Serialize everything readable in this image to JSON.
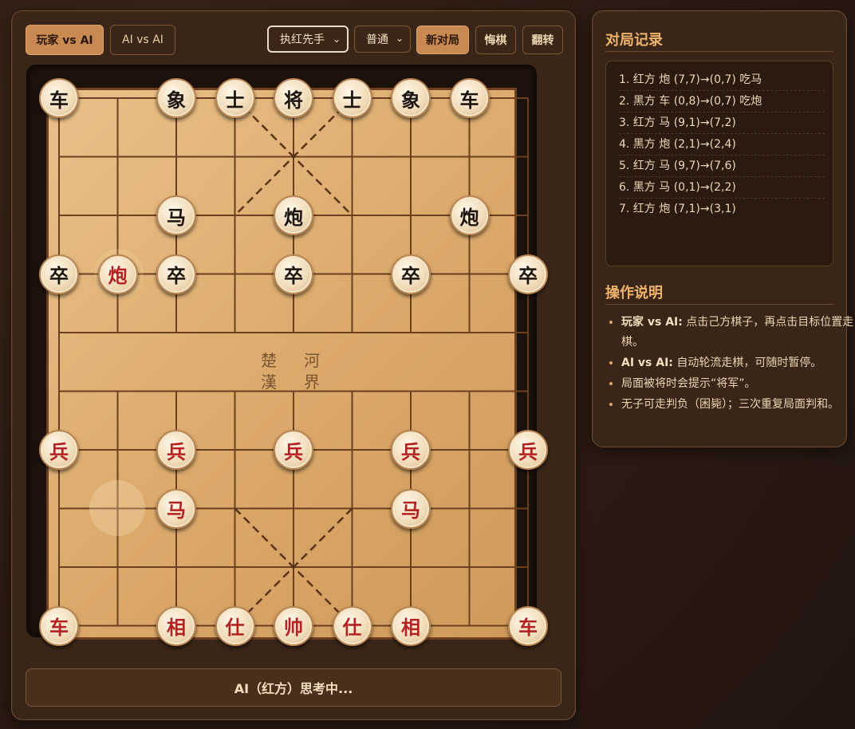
{
  "tabs": [
    {
      "label": "玩家 vs AI",
      "active": true
    },
    {
      "label": "AI vs AI",
      "active": false
    }
  ],
  "controls": {
    "side_select": "执红先手",
    "level_select": "普通",
    "new_game": "新对局",
    "undo": "悔棋",
    "flip": "翻转"
  },
  "board": {
    "river_left": [
      "楚",
      "漢"
    ],
    "river_right": [
      "河",
      "界"
    ],
    "pieces": [
      {
        "col": 0,
        "row": 0,
        "char": "车",
        "side": "black"
      },
      {
        "col": 2,
        "row": 0,
        "char": "象",
        "side": "black"
      },
      {
        "col": 3,
        "row": 0,
        "char": "士",
        "side": "black"
      },
      {
        "col": 4,
        "row": 0,
        "char": "将",
        "side": "black"
      },
      {
        "col": 5,
        "row": 0,
        "char": "士",
        "side": "black"
      },
      {
        "col": 6,
        "row": 0,
        "char": "象",
        "side": "black"
      },
      {
        "col": 7,
        "row": 0,
        "char": "车",
        "side": "black"
      },
      {
        "col": 2,
        "row": 2,
        "char": "马",
        "side": "black"
      },
      {
        "col": 4,
        "row": 2,
        "char": "炮",
        "side": "black"
      },
      {
        "col": 7,
        "row": 2,
        "char": "炮",
        "side": "black"
      },
      {
        "col": 0,
        "row": 3,
        "char": "卒",
        "side": "black"
      },
      {
        "col": 1,
        "row": 3,
        "char": "炮",
        "side": "red"
      },
      {
        "col": 2,
        "row": 3,
        "char": "卒",
        "side": "black"
      },
      {
        "col": 4,
        "row": 3,
        "char": "卒",
        "side": "black"
      },
      {
        "col": 6,
        "row": 3,
        "char": "卒",
        "side": "black"
      },
      {
        "col": 8,
        "row": 3,
        "char": "卒",
        "side": "black"
      },
      {
        "col": 0,
        "row": 6,
        "char": "兵",
        "side": "red"
      },
      {
        "col": 2,
        "row": 6,
        "char": "兵",
        "side": "red"
      },
      {
        "col": 4,
        "row": 6,
        "char": "兵",
        "side": "red"
      },
      {
        "col": 6,
        "row": 6,
        "char": "兵",
        "side": "red"
      },
      {
        "col": 8,
        "row": 6,
        "char": "兵",
        "side": "red"
      },
      {
        "col": 2,
        "row": 7,
        "char": "马",
        "side": "red"
      },
      {
        "col": 6,
        "row": 7,
        "char": "马",
        "side": "red"
      },
      {
        "col": 0,
        "row": 9,
        "char": "车",
        "side": "red"
      },
      {
        "col": 2,
        "row": 9,
        "char": "相",
        "side": "red"
      },
      {
        "col": 3,
        "row": 9,
        "char": "仕",
        "side": "red"
      },
      {
        "col": 4,
        "row": 9,
        "char": "帅",
        "side": "red"
      },
      {
        "col": 5,
        "row": 9,
        "char": "仕",
        "side": "red"
      },
      {
        "col": 6,
        "row": 9,
        "char": "相",
        "side": "red"
      },
      {
        "col": 8,
        "row": 9,
        "char": "车",
        "side": "red"
      }
    ]
  },
  "status": "AI（红方）思考中...",
  "history": {
    "title": "对局记录",
    "moves": [
      "1. 红方 炮 (7,7)→(0,7) 吃马",
      "2. 黑方 车 (0,8)→(0,7) 吃炮",
      "3. 红方 马 (9,1)→(7,2)",
      "4. 黑方 炮 (2,1)→(2,4)",
      "5. 红方 马 (9,7)→(7,6)",
      "6. 黑方 马 (0,1)→(2,2)",
      "7. 红方 炮 (7,1)→(3,1)"
    ]
  },
  "help": {
    "title": "操作说明",
    "items": [
      {
        "bold": "玩家 vs AI:",
        "text": " 点击己方棋子，再点击目标位置走棋。"
      },
      {
        "bold": "AI vs AI:",
        "text": " 自动轮流走棋，可随时暂停。"
      },
      {
        "bold": "",
        "text": "局面被将时会提示“将军”。"
      },
      {
        "bold": "",
        "text": "无子可走判负（困毙）；三次重复局面判和。"
      }
    ]
  }
}
